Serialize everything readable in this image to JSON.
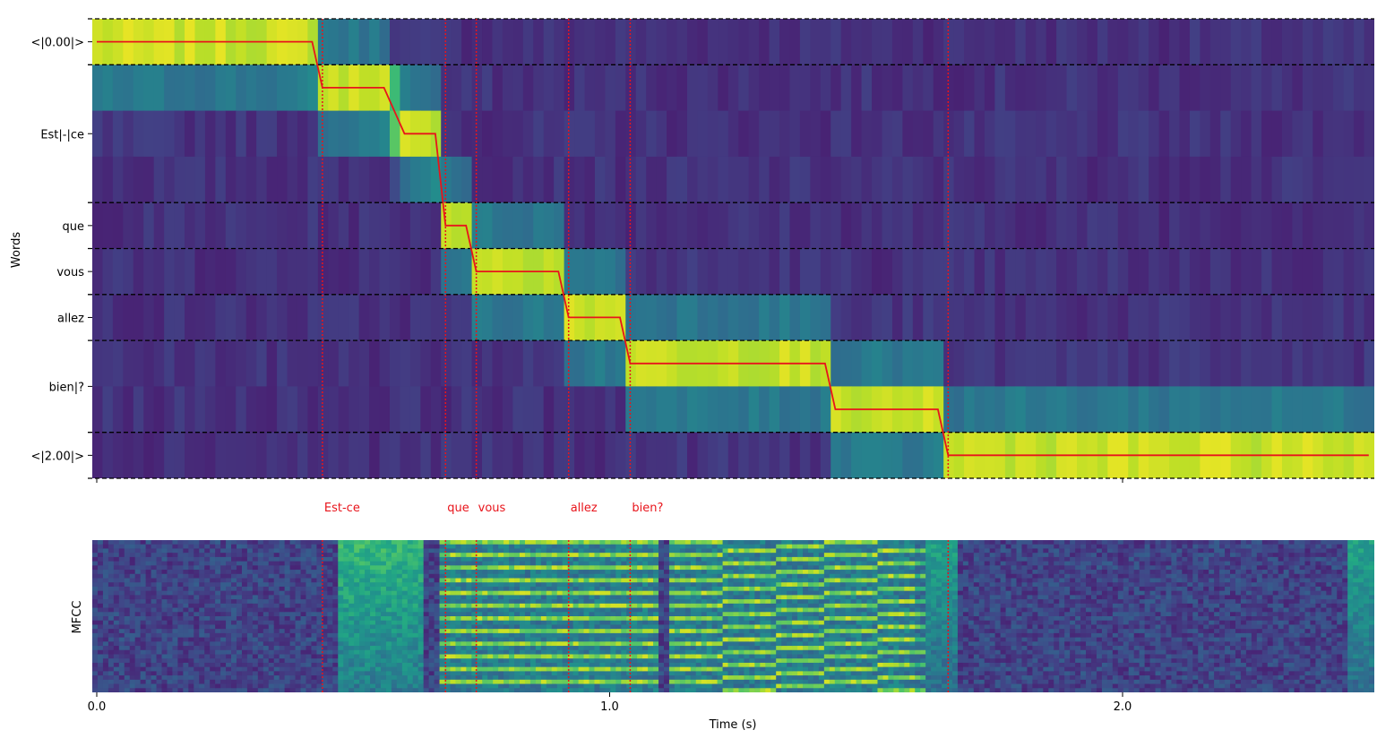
{
  "chart_data": [
    {
      "type": "heatmap",
      "title": "",
      "ylabel": "Words",
      "xlabel": "",
      "x_unit": "s",
      "xlim": [
        0.0,
        2.5
      ],
      "xticks": [
        0.0,
        2.0
      ],
      "ytick_labels": [
        "<|0.00|>",
        "Est|-|ce",
        "que",
        "vous",
        "allez",
        "bien|?",
        "<|2.00|>"
      ],
      "token_rows": 10,
      "token_groups": [
        {
          "label": "<|0.00|>",
          "start_row": 0,
          "row_count": 1
        },
        {
          "label": "Est|-|ce",
          "start_row": 1,
          "row_count": 3
        },
        {
          "label": "que",
          "start_row": 4,
          "row_count": 1
        },
        {
          "label": "vous",
          "start_row": 5,
          "row_count": 1
        },
        {
          "label": "allez",
          "start_row": 6,
          "row_count": 1
        },
        {
          "label": "bien|?",
          "start_row": 7,
          "row_count": 2
        },
        {
          "label": "<|2.00|>",
          "start_row": 9,
          "row_count": 1
        }
      ],
      "alignment_path": {
        "times": [
          0.0,
          0.42,
          0.44,
          0.56,
          0.6,
          0.66,
          0.68,
          0.72,
          0.74,
          0.9,
          0.92,
          1.02,
          1.04,
          1.42,
          1.44,
          1.64,
          1.66,
          2.48
        ],
        "rows": [
          0,
          0,
          1,
          1,
          2,
          2,
          4,
          4,
          5,
          5,
          6,
          6,
          7,
          7,
          8,
          8,
          9,
          9
        ]
      },
      "colormap": "viridis",
      "path_color": "#e8141b",
      "grid": false
    },
    {
      "type": "heatmap",
      "title": "",
      "ylabel": "MFCC",
      "xlabel": "Time (s)",
      "xlim": [
        0.0,
        2.5
      ],
      "xticks": [
        0.0,
        1.0,
        2.0
      ],
      "colormap": "viridis",
      "grid": false
    }
  ],
  "word_boundaries": [
    {
      "word": "Est-ce",
      "time": 0.44
    },
    {
      "word": "que",
      "time": 0.68
    },
    {
      "word": "vous",
      "time": 0.74
    },
    {
      "word": "allez",
      "time": 0.92
    },
    {
      "word": "bien?",
      "time": 1.04
    },
    {
      "word": "",
      "time": 1.66
    }
  ],
  "boundary_color": "#e8141b"
}
